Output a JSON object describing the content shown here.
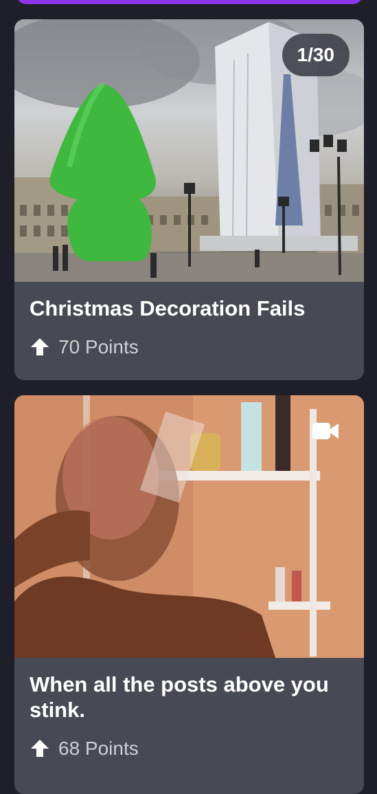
{
  "feed": {
    "posts": [
      {
        "counter": "1/30",
        "title": "Christmas Decoration Fails",
        "points": "70 Points",
        "media_type": "image"
      },
      {
        "title": "When all the posts above you stink.",
        "points": "68 Points",
        "media_type": "video"
      }
    ]
  },
  "colors": {
    "background": "#1f1f2a",
    "card": "#474a54",
    "accent": "#8e34e8",
    "text": "#ffffff",
    "muted_text": "#cfd0d4"
  },
  "icons": {
    "upvote": "upvote-arrow-icon",
    "video": "video-camera-icon"
  }
}
